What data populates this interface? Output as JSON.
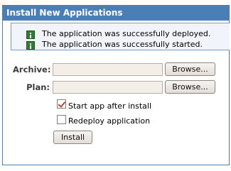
{
  "panel": {
    "title": "Install New Applications"
  },
  "messages": [
    {
      "icon": "info-icon",
      "text": "The application was successfully deployed."
    },
    {
      "icon": "info-icon",
      "text": "The application was successfully started."
    }
  ],
  "form": {
    "archive": {
      "label": "Archive:",
      "value": "",
      "browse_label": "Browse..."
    },
    "plan": {
      "label": "Plan:",
      "value": "",
      "browse_label": "Browse..."
    },
    "start_after_install": {
      "label": "Start app after install",
      "checked": true
    },
    "redeploy": {
      "label": "Redeploy application",
      "checked": false
    },
    "install_label": "Install"
  },
  "colors": {
    "header_bg": "#4a7eb7",
    "field_bg": "#f4eee9",
    "message_bg": "#f1f5fb"
  }
}
